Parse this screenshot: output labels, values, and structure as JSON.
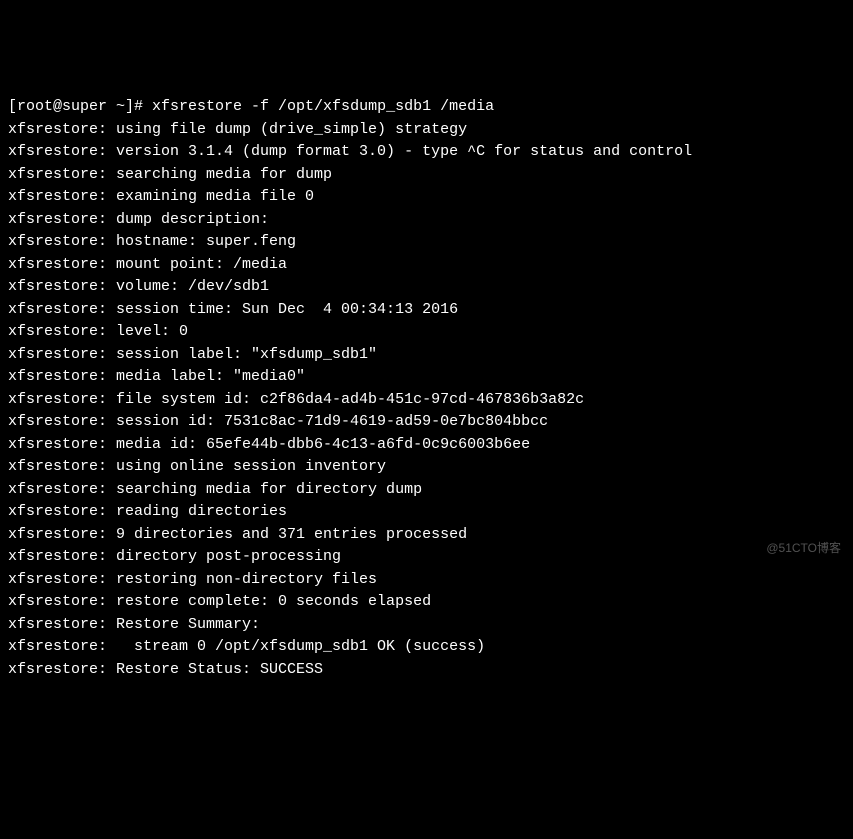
{
  "prompt": "[root@super ~]# ",
  "command": "xfsrestore -f /opt/xfsdump_sdb1 /media",
  "lines": [
    "xfsrestore: using file dump (drive_simple) strategy",
    "xfsrestore: version 3.1.4 (dump format 3.0) - type ^C for status and control",
    "xfsrestore: searching media for dump",
    "xfsrestore: examining media file 0",
    "xfsrestore: dump description:",
    "xfsrestore: hostname: super.feng",
    "xfsrestore: mount point: /media",
    "xfsrestore: volume: /dev/sdb1",
    "xfsrestore: session time: Sun Dec  4 00:34:13 2016",
    "xfsrestore: level: 0",
    "xfsrestore: session label: \"xfsdump_sdb1\"",
    "xfsrestore: media label: \"media0\"",
    "xfsrestore: file system id: c2f86da4-ad4b-451c-97cd-467836b3a82c",
    "xfsrestore: session id: 7531c8ac-71d9-4619-ad59-0e7bc804bbcc",
    "xfsrestore: media id: 65efe44b-dbb6-4c13-a6fd-0c9c6003b6ee",
    "xfsrestore: using online session inventory",
    "xfsrestore: searching media for directory dump",
    "xfsrestore: reading directories",
    "xfsrestore: 9 directories and 371 entries processed",
    "xfsrestore: directory post-processing",
    "xfsrestore: restoring non-directory files",
    "xfsrestore: restore complete: 0 seconds elapsed",
    "xfsrestore: Restore Summary:",
    "xfsrestore:   stream 0 /opt/xfsdump_sdb1 OK (success)",
    "xfsrestore: Restore Status: SUCCESS"
  ],
  "watermark": "@51CTO博客"
}
